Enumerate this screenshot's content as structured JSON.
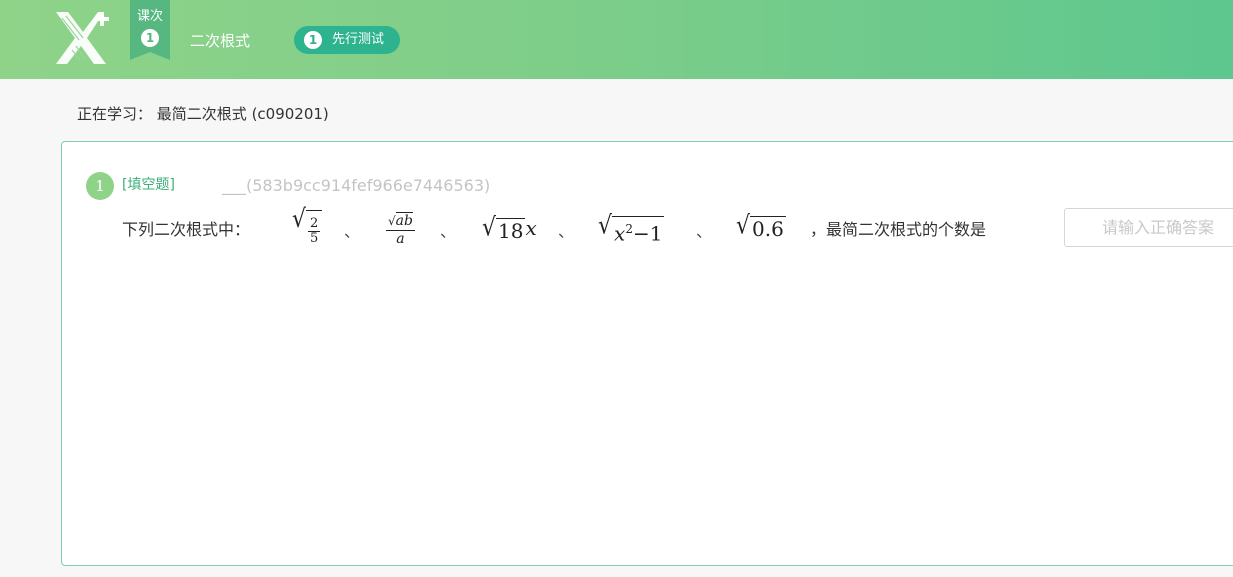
{
  "header": {
    "lesson_flag_label": "课次",
    "lesson_number": "1",
    "course_title": "二次根式",
    "step": {
      "number": "1",
      "label": "先行测试"
    }
  },
  "studying": {
    "prefix": "正在学习：",
    "topic": "最简二次根式 (c090201)"
  },
  "question": {
    "number": "1",
    "type": "[填空题]",
    "id_text": "___(583b9cc914fef966e7446563)",
    "stem_prefix": "下列二次根式中：",
    "separator": "、",
    "math": {
      "expr1_num": "2",
      "expr1_den": "5",
      "expr2_num_var": "ab",
      "expr2_den": "a",
      "expr3_num": "18",
      "expr3_var": "x",
      "expr4_base": "x",
      "expr4_exp": "2",
      "expr4_rest": "−1",
      "expr5_num": "0.6"
    },
    "stem_suffix": "，最简二次根式的个数是",
    "answer_placeholder": "请输入正确答案",
    "answer_value": "",
    "end_punct": "."
  },
  "colors": {
    "header_start": "#8fd389",
    "header_end": "#5dc78e",
    "accent": "#2db38d",
    "card_border": "#7fcfae"
  }
}
